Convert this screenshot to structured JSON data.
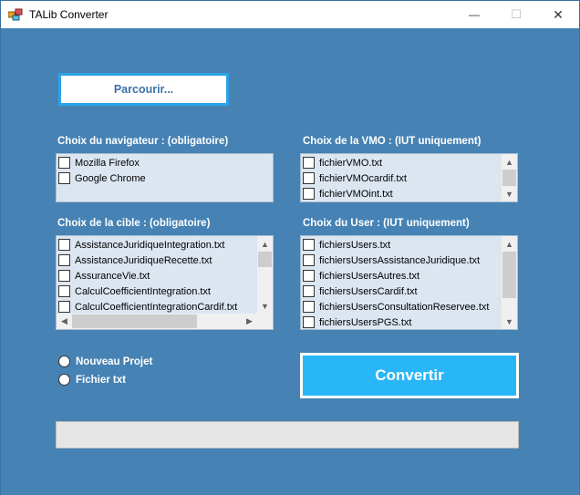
{
  "window": {
    "title": "TALib Converter",
    "minimize_glyph": "—",
    "maximize_glyph": "☐",
    "close_glyph": "✕"
  },
  "browse_button": {
    "label": "Parcourir..."
  },
  "browser_list": {
    "label": "Choix du navigateur :  (obligatoire)",
    "items": [
      "Mozilla Firefox",
      "Google Chrome"
    ]
  },
  "vmo_list": {
    "label": "Choix de la VMO :  (IUT uniquement)",
    "items": [
      "fichierVMO.txt",
      "fichierVMOcardif.txt",
      "fichierVMOint.txt"
    ]
  },
  "target_list": {
    "label": "Choix de la cible :  (obligatoire)",
    "items": [
      "AssistanceJuridiqueIntegration.txt",
      "AssistanceJuridiqueRecette.txt",
      "AssuranceVie.txt",
      "CalculCoefficientIntegration.txt",
      "CalculCoefficientIntegrationCardif.txt"
    ]
  },
  "user_list": {
    "label": "Choix du User :  (IUT uniquement)",
    "items": [
      "fichiersUsers.txt",
      "fichiersUsersAssistanceJuridique.txt",
      "fichiersUsersAutres.txt",
      "fichiersUsersCardif.txt",
      "fichiersUsersConsultationReservee.txt",
      "fichiersUsersPGS.txt"
    ]
  },
  "mode": {
    "options": [
      "Nouveau Projet",
      "Fichier txt"
    ]
  },
  "convert_button": {
    "label": "Convertir"
  },
  "progress": {
    "value": 0
  },
  "icons": {
    "scroll_up": "▲",
    "scroll_down": "▼",
    "scroll_left": "◀",
    "scroll_right": "▶"
  },
  "colors": {
    "background": "#4682b4",
    "accent": "#29b6f6",
    "list_background": "#dce6f1"
  }
}
